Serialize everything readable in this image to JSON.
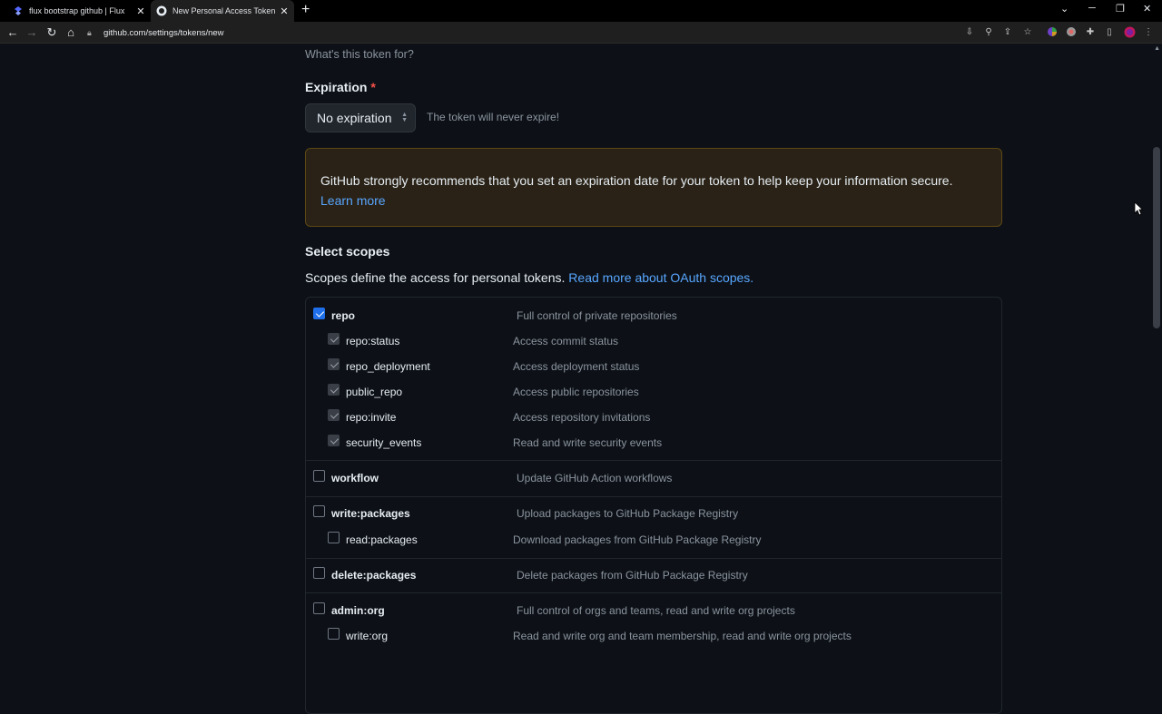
{
  "browser": {
    "tabs": [
      {
        "title": "flux bootstrap github | Flux"
      },
      {
        "title": "New Personal Access Token (Clas"
      }
    ],
    "url": "github.com/settings/tokens/new"
  },
  "page": {
    "note_hint": "What's this token for?",
    "expiration": {
      "label": "Expiration",
      "required_mark": "*",
      "selected": "No expiration",
      "note": "The token will never expire!"
    },
    "flash": {
      "text": "GitHub strongly recommends that you set an expiration date for your token to help keep your information secure.",
      "link": "Learn more"
    },
    "scopes": {
      "title": "Select scopes",
      "desc": "Scopes define the access for personal tokens.",
      "desc_link": "Read more about OAuth scopes.",
      "groups": [
        {
          "name": "repo",
          "desc": "Full control of private repositories",
          "checked": true,
          "children": [
            {
              "name": "repo:status",
              "desc": "Access commit status",
              "checked": true
            },
            {
              "name": "repo_deployment",
              "desc": "Access deployment status",
              "checked": true
            },
            {
              "name": "public_repo",
              "desc": "Access public repositories",
              "checked": true
            },
            {
              "name": "repo:invite",
              "desc": "Access repository invitations",
              "checked": true
            },
            {
              "name": "security_events",
              "desc": "Read and write security events",
              "checked": true
            }
          ]
        },
        {
          "name": "workflow",
          "desc": "Update GitHub Action workflows",
          "checked": false,
          "children": []
        },
        {
          "name": "write:packages",
          "desc": "Upload packages to GitHub Package Registry",
          "checked": false,
          "children": [
            {
              "name": "read:packages",
              "desc": "Download packages from GitHub Package Registry",
              "checked": false
            }
          ]
        },
        {
          "name": "delete:packages",
          "desc": "Delete packages from GitHub Package Registry",
          "checked": false,
          "children": []
        },
        {
          "name": "admin:org",
          "desc": "Full control of orgs and teams, read and write org projects",
          "checked": false,
          "children": [
            {
              "name": "write:org",
              "desc": "Read and write org and team membership, read and write org projects",
              "checked": false
            }
          ]
        }
      ]
    }
  }
}
